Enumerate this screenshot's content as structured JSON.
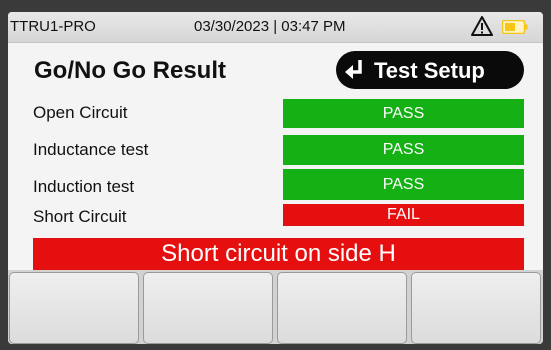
{
  "status_bar": {
    "device_name": "TTRU1-PRO",
    "datetime": "03/30/2023 | 03:47 PM",
    "warning_icon": "warning-triangle-icon",
    "battery_icon": "battery-icon",
    "battery_color": "#f5c518"
  },
  "header": {
    "title": "Go/No Go Result",
    "test_setup_button": {
      "label": "Test Setup",
      "icon": "return-arrow-icon"
    }
  },
  "results": [
    {
      "label": "Open Circuit",
      "result": "PASS",
      "status": "pass"
    },
    {
      "label": "Inductance test",
      "result": "PASS",
      "status": "pass"
    },
    {
      "label": "Induction test",
      "result": "PASS",
      "status": "pass"
    },
    {
      "label": "Short Circuit",
      "result": "FAIL",
      "status": "fail"
    }
  ],
  "message": "Short circuit on side H",
  "softkeys": [
    "",
    "",
    "",
    ""
  ],
  "colors": {
    "pass": "#14b014",
    "fail": "#e60f0f"
  }
}
